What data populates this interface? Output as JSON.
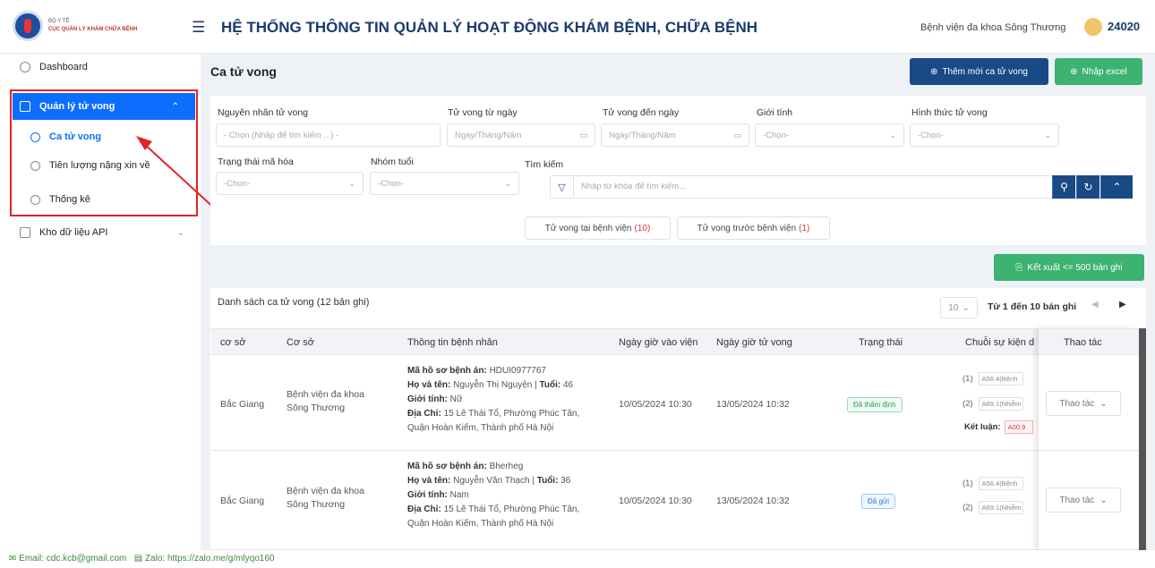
{
  "header": {
    "logo_line1": "BỘ Y TẾ",
    "logo_line2": "CỤC QUẢN LÝ KHÁM CHỮA BỆNH",
    "system_title": "HỆ THỐNG THÔNG TIN QUẢN LÝ HOẠT ĐỘNG KHÁM BỆNH, CHỮA BỆNH",
    "hospital": "Bệnh viện đa khoa Sông Thương",
    "user_id": "24020"
  },
  "sidebar": {
    "dashboard": "Dashboard",
    "death_mgmt": "Quản lý tử vong",
    "sub_cases": "Ca tử vong",
    "sub_prognosis": "Tiên lượng nặng xin về",
    "sub_stats": "Thống kê",
    "api_store": "Kho dữ liệu API"
  },
  "page": {
    "title": "Ca tử vong",
    "add_button": "Thêm mới ca tử vong",
    "import_button": "Nhập excel"
  },
  "filters": {
    "cause_label": "Nguyên nhân tử vong",
    "cause_placeholder": "- Chọn (Nhập để tìm kiếm ...) -",
    "from_label": "Tử vong từ ngày",
    "from_placeholder": "Ngày/Tháng/Năm",
    "to_label": "Tử vong đến ngày",
    "to_placeholder": "Ngày/Tháng/Năm",
    "gender_label": "Giới tính",
    "gender_placeholder": "-Chọn-",
    "form_label": "Hình thức tử vong",
    "form_placeholder": "-Chọn-",
    "code_status_label": "Trạng thái mã hóa",
    "code_status_placeholder": "-Chọn-",
    "age_group_label": "Nhóm tuổi",
    "age_group_placeholder": "-Chọn-",
    "search_label": "Tìm kiếm",
    "search_placeholder": "Nhập từ khóa để tìm kiếm..."
  },
  "tabs": {
    "in_hospital": "Tử vong tại bệnh viện",
    "in_hospital_count": "(10)",
    "before_hospital": "Tử vong trước bệnh viện",
    "before_hospital_count": "(1)"
  },
  "export_button": "Kết xuất <= 500 bản ghi",
  "list": {
    "title": "Danh sách ca tử vong (12 bản ghi)",
    "page_size": "10",
    "page_info": "Từ 1 đến 10 bản ghi"
  },
  "columns": {
    "c1": "cơ sở",
    "c2": "Cơ sở",
    "c3": "Thông tin bệnh nhân",
    "c4": "Ngày giờ vào viện",
    "c5": "Ngày giờ tử vong",
    "c6": "Trạng thái",
    "c7": "Chuỗi sự kiện d",
    "c8": "Thao tác"
  },
  "labels": {
    "record": "Mã hồ sơ bệnh án:",
    "name": "Họ và tên:",
    "age": "Tuổi:",
    "gender": "Giới tính:",
    "address": "Địa Chỉ:",
    "conclusion": "Kết luận:",
    "action": "Thao tác"
  },
  "rows": [
    {
      "province": "Bắc Giang",
      "facility_l1": "Bệnh viện đa khoa",
      "facility_l2": "Sông Thương",
      "record": "HDUI0977767",
      "name": "Nguyễn Thị Nguyện",
      "age": "46",
      "gender": "Nữ",
      "address_l1": "15 Lê Thái Tổ, Phường Phúc Tân,",
      "address_l2": "Quận Hoàn Kiếm, Thành phố Hà Nội",
      "admitted": "10/05/2024 10:30",
      "death": "13/05/2024 10:32",
      "status": "Đã thẩm định",
      "event1_idx": "(1)",
      "event1": "A56.4(Bệnh",
      "event2_idx": "(2)",
      "event2": "A69.1(Nhiễm",
      "conclusion": "A00.9"
    },
    {
      "province": "Bắc Giang",
      "facility_l1": "Bệnh viện đa khoa",
      "facility_l2": "Sông Thương",
      "record": "Bherheg",
      "name": "Nguyễn Văn Thạch",
      "age": "36",
      "gender": "Nam",
      "address_l1": "15 Lê Thái Tổ, Phường Phúc Tân,",
      "address_l2": "Quận Hoàn Kiếm, Thành phố Hà Nội",
      "admitted": "10/05/2024 10:30",
      "death": "13/05/2024 10:32",
      "status": "Đã gửi",
      "event1_idx": "(1)",
      "event1": "A56.4(Bệnh",
      "event2_idx": "(2)",
      "event2": "A69.1(Nhiễm"
    }
  ],
  "footer": {
    "email": "Email: cdc.kcb@gmail.com",
    "zalo": "Zalo: https://zalo.me/g/mlyqo160"
  },
  "colors": {
    "primary": "#1a4a86",
    "accent": "#0d6efd",
    "green": "#3cb371",
    "highlight": "#e32424"
  }
}
